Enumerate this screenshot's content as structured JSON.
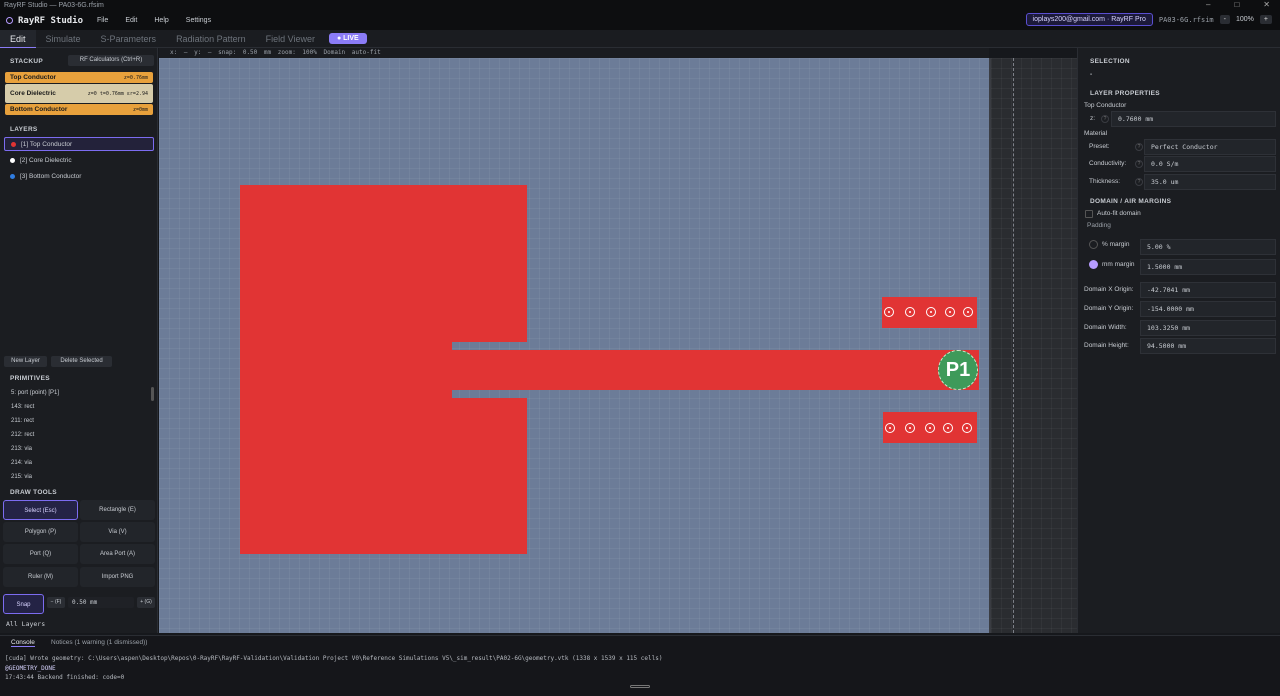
{
  "window": {
    "title": "RayRF Studio — PA03-6G.rfsim"
  },
  "menu": {
    "brand": "RayRF Studio",
    "items": [
      "File",
      "Edit",
      "Help",
      "Settings"
    ],
    "account": "ioplays200@gmail.com · RayRF Pro",
    "file": "PA03-6G.rfsim",
    "zoom_minus": "-",
    "zoom": "100%",
    "zoom_plus": "+"
  },
  "tabs": [
    "Edit",
    "Simulate",
    "S-Parameters",
    "Radiation Pattern",
    "Field Viewer"
  ],
  "live": "● LIVE",
  "status_line": {
    "x": "x: —",
    "y": "y: —",
    "snap": "snap: 0.50 mm",
    "zoom": "zoom: 100%",
    "domain": "Domain auto-fit"
  },
  "stackup": {
    "title": "STACKUP",
    "calc": "RF Calculators (Ctrl+R)",
    "items": [
      {
        "name": "Top Conductor",
        "meta": "z=0.76mm",
        "color": "#e8a13c"
      },
      {
        "name": "Core Dielectric",
        "meta": "z=0   t=0.76mm   εr=2.94",
        "color": "#d6ccaa"
      },
      {
        "name": "Bottom Conductor",
        "meta": "z=0mm",
        "color": "#e8a13c"
      }
    ]
  },
  "layers": {
    "title": "LAYERS",
    "items": [
      {
        "label": "[1] Top Conductor",
        "color": "#e13434"
      },
      {
        "label": "[2] Core Dielectric",
        "color": "#ffffff"
      },
      {
        "label": "[3] Bottom Conductor",
        "color": "#2f7de1"
      }
    ]
  },
  "layer_buttons": {
    "new": "New Layer",
    "delete": "Delete Selected"
  },
  "primitives": {
    "title": "PRIMITIVES",
    "items": [
      "5: port (point) [P1]",
      "143: rect",
      "211: rect",
      "212: rect",
      "213: via",
      "214: via",
      "215: via"
    ]
  },
  "draw_tools": {
    "title": "DRAW TOOLS",
    "items": [
      "Select (Esc)",
      "Rectangle (E)",
      "Polygon (P)",
      "Via (V)",
      "Port (Q)",
      "Area Port (A)",
      "Ruler (M)",
      "Import PNG"
    ]
  },
  "snap": {
    "label": "Snap",
    "minus": "− (F)",
    "value": "0.50 mm",
    "plus": "+ (G)"
  },
  "all_layers": "All Layers",
  "canvas": {
    "port_label": "P1"
  },
  "right": {
    "selection_title": "SELECTION",
    "selection_value": "-",
    "layer_props_title": "LAYER PROPERTIES",
    "layer_name": "Top Conductor",
    "z_label": "z:",
    "z_value": "0.7600 mm",
    "material_title": "Material",
    "preset_label": "Preset:",
    "preset_value": "Perfect Conductor",
    "cond_label": "Conductivity:",
    "cond_value": "0.0 S/m",
    "thick_label": "Thickness:",
    "thick_value": "35.0 um",
    "domain_title": "DOMAIN / AIR MARGINS",
    "autofit": "Auto-fit domain",
    "padding": "Padding",
    "pct_label": "% margin",
    "pct_value": "5.00 %",
    "mm_label": "mm margin",
    "mm_value": "1.5000 mm",
    "dx_label": "Domain X Origin:",
    "dx_value": "-42.7041 mm",
    "dy_label": "Domain Y Origin:",
    "dy_value": "-154.0000 mm",
    "dw_label": "Domain Width:",
    "dw_value": "103.3250 mm",
    "dh_label": "Domain Height:",
    "dh_value": "94.5000 mm"
  },
  "console": {
    "tabs": [
      "Console",
      "Notices (1 warning (1 dismissed))"
    ],
    "lines": [
      "[cuda] Wrote geometry: C:\\Users\\aspen\\Desktop\\Repos\\0-RayRF\\RayRF-Validation\\Validation Project V0\\Reference Simulations V5\\_sim_result\\PA02-6G\\geometry.vtk  (1338 x 1539 x 115 cells)",
      "@GEOMETRY_DONE",
      "17:43:44  Backend finished: code=0"
    ]
  }
}
